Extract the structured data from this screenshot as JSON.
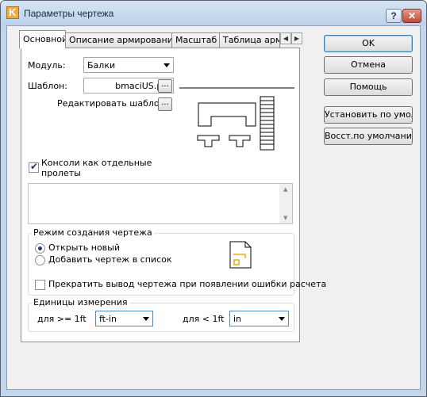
{
  "window": {
    "title": "Параметры чертежа",
    "help_glyph": "?",
    "close_glyph": "✕"
  },
  "tabs": [
    {
      "label": "Основной",
      "active": true
    },
    {
      "label": "Описание армирования",
      "active": false
    },
    {
      "label": "Масштаб",
      "active": false
    },
    {
      "label": "Таблица арм",
      "active": false
    }
  ],
  "tab_scroll": {
    "left": "◀",
    "right": "▶"
  },
  "main": {
    "module_label": "Модуль:",
    "module_value": "Балки",
    "template_label": "Шаблон:",
    "template_value": "bmaciUS.plo",
    "browse_glyph": "...",
    "edit_template_label": "Редактировать шаблон:",
    "consoles_label": "Консоли как отдельные пролеты",
    "consoles_checked": true,
    "mode_group": {
      "title": "Режим создания чертежа",
      "option_new": "Открыть новый",
      "option_add": "Добавить чертеж в список",
      "selected": "new",
      "stop_on_error_label": "Прекратить вывод чертежа при появлении ошибки расчета",
      "stop_on_error_checked": false
    },
    "units_group": {
      "title": "Единицы измерения",
      "ge_label": "для >= 1ft",
      "ge_value": "ft-in",
      "lt_label": "для < 1ft",
      "lt_value": "in"
    }
  },
  "buttons": {
    "ok": "OK",
    "cancel": "Отмена",
    "help": "Помощь",
    "set_default": "Установить по умолч.",
    "restore_default": "Восст.по умолчанию"
  },
  "colors": {
    "accent": "#3c7fb1",
    "title_bar": "#c3d5ea",
    "close": "#c54a35",
    "doc_icon_mark": "#d9b01c"
  }
}
